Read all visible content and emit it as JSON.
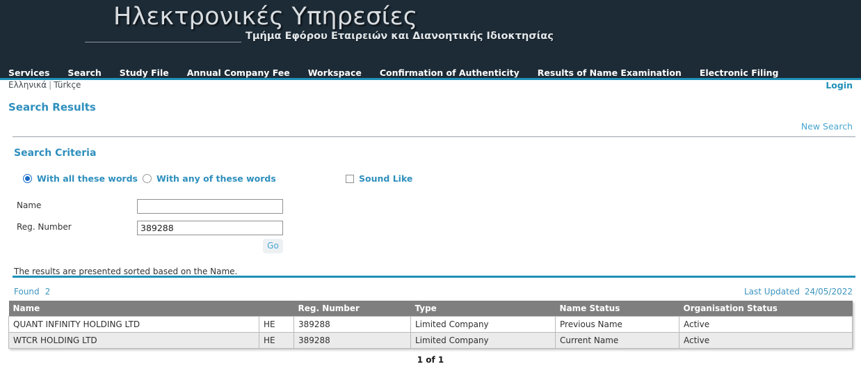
{
  "banner": {
    "title": "Ηλεκτρονικές Υπηρεσίες",
    "subtitle": "Τμήμα Εφόρου Εταιρειών και Διανοητικής Ιδιοκτησίας",
    "background_color": "#1d2b36",
    "accent_color": "#1f90b8"
  },
  "nav": {
    "items": [
      {
        "label": "Services"
      },
      {
        "label": "Search"
      },
      {
        "label": "Study File"
      },
      {
        "label": "Annual Company Fee"
      },
      {
        "label": "Workspace"
      },
      {
        "label": "Confirmation of Authenticity"
      },
      {
        "label": "Results of Name Examination"
      },
      {
        "label": "Electronic Filing"
      }
    ]
  },
  "language_bar": {
    "greek": "Ελληνικά",
    "separator": "|",
    "turkish": "Türkçe",
    "login": "Login"
  },
  "page": {
    "title": "Search Results",
    "new_search": "New Search"
  },
  "search_criteria": {
    "heading": "Search Criteria",
    "options": [
      {
        "label": "With all these words",
        "type": "radio",
        "checked": true
      },
      {
        "label": "With any of these words",
        "type": "radio",
        "checked": false
      },
      {
        "label": "Sound Like",
        "type": "checkbox",
        "checked": false
      }
    ],
    "fields": [
      {
        "label": "Name",
        "value": "",
        "placeholder": ""
      },
      {
        "label": "Reg. Number",
        "value": "389288",
        "placeholder": ""
      }
    ],
    "go_label": "Go"
  },
  "results": {
    "sort_note": "The results are presented sorted based on the Name.",
    "found_label": "Found",
    "found_count": "2",
    "last_updated_label": "Last Updated",
    "last_updated_date": "24/05/2022",
    "columns": [
      "Name",
      "",
      "Reg. Number",
      "Type",
      "Name Status",
      "Organisation Status"
    ],
    "rows": [
      {
        "name": "QUANT INFINITY HOLDING LTD",
        "prefix": "HE",
        "reg_number": "389288",
        "type": "Limited Company",
        "name_status": "Previous Name",
        "organisation_status": "Active"
      },
      {
        "name": "WTCR HOLDING LTD",
        "prefix": "HE",
        "reg_number": "389288",
        "type": "Limited Company",
        "name_status": "Current Name",
        "organisation_status": "Active"
      }
    ],
    "pager": "1 of 1"
  }
}
